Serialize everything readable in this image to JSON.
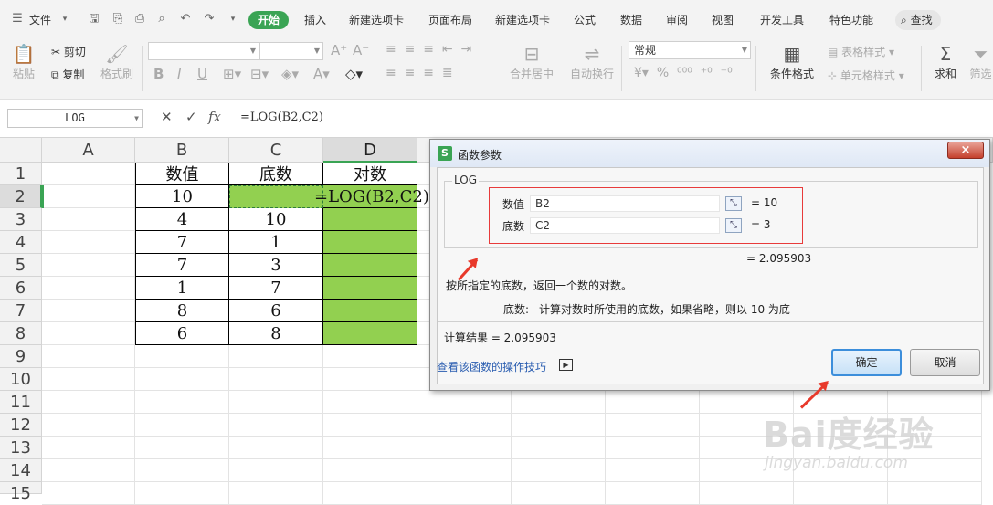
{
  "menubar": {
    "file_label": "文件",
    "tabs": [
      "开始",
      "插入",
      "新建选项卡",
      "页面布局",
      "新建选项卡",
      "公式",
      "数据",
      "审阅",
      "视图",
      "开发工具",
      "特色功能"
    ],
    "active_tab": "开始",
    "search_label": "查找"
  },
  "ribbon": {
    "paste": "粘贴",
    "cut": "剪切",
    "copy": "复制",
    "format_painter": "格式刷",
    "font_name": "",
    "font_size": "",
    "merge_center": "合并居中",
    "wrap_text": "自动换行",
    "number_format": "常规",
    "conditional_format": "条件格式",
    "table_style": "表格样式",
    "cell_style": "单元格样式",
    "sum": "求和",
    "filter": "筛选"
  },
  "formula_bar": {
    "name_box": "LOG",
    "fx": "fx",
    "formula": "=LOG(B2,C2)"
  },
  "sheet": {
    "columns": [
      "A",
      "B",
      "C",
      "D"
    ],
    "selected_column": "D",
    "rows": [
      "1",
      "2",
      "3",
      "4",
      "5",
      "6",
      "7",
      "8",
      "9",
      "10",
      "11",
      "12",
      "13",
      "14",
      "15"
    ],
    "selected_row": "2",
    "headers": [
      "数值",
      "底数",
      "对数"
    ],
    "data": [
      {
        "b": "10",
        "c": "",
        "d": "=LOG(B2,C2)"
      },
      {
        "b": "4",
        "c": "10",
        "d": ""
      },
      {
        "b": "7",
        "c": "1",
        "d": ""
      },
      {
        "b": "7",
        "c": "3",
        "d": ""
      },
      {
        "b": "1",
        "c": "7",
        "d": ""
      },
      {
        "b": "8",
        "c": "6",
        "d": ""
      },
      {
        "b": "6",
        "c": "8",
        "d": ""
      }
    ],
    "highlight_color": "#92d050"
  },
  "dialog": {
    "title": "函数参数",
    "function_name": "LOG",
    "args": [
      {
        "label": "数值",
        "value": "B2",
        "result": "= 10"
      },
      {
        "label": "底数",
        "value": "C2",
        "result": "= 3"
      }
    ],
    "function_result": "= 2.095903",
    "description": "按所指定的底数，返回一个数的对数。",
    "arg_help_label": "底数:",
    "arg_help": "计算对数时所使用的底数，如果省略，则以 10 为底",
    "calc_result": "计算结果 = 2.095903",
    "help_link": "查看该函数的操作技巧",
    "ok": "确定",
    "cancel": "取消",
    "close": "×"
  },
  "watermark": {
    "logo": "Bai度经验",
    "url": "jingyan.baidu.com"
  }
}
